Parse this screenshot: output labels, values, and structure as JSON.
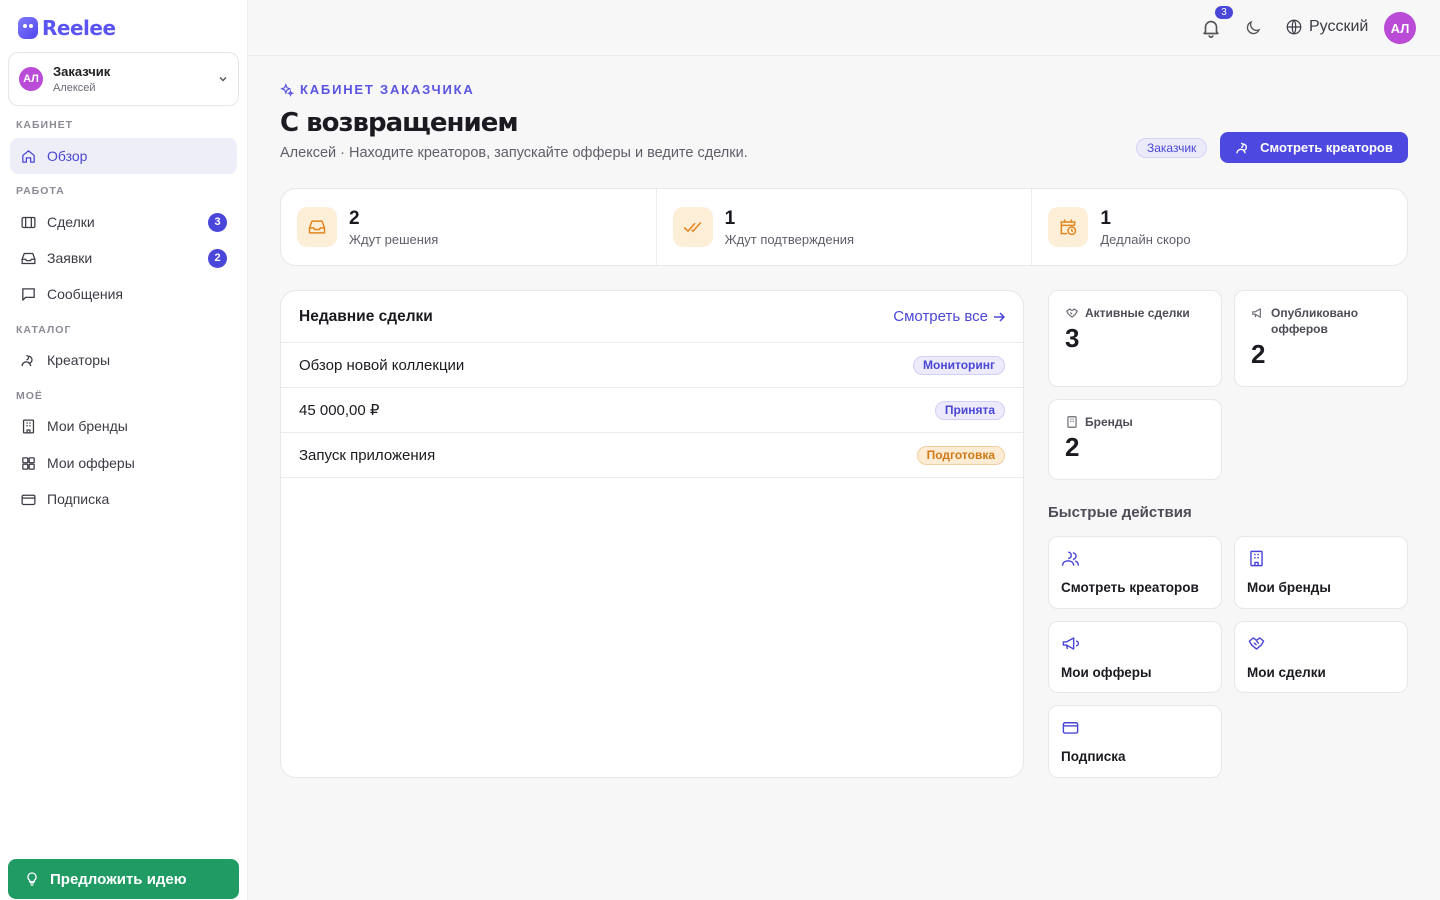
{
  "app": {
    "name": "Reelee"
  },
  "account": {
    "initials": "АЛ",
    "role": "Заказчик",
    "name": "Алексей"
  },
  "sidebar": {
    "sections": [
      "КАБИНЕТ",
      "РАБОТА",
      "КАТАЛОГ",
      "МОЁ"
    ],
    "items": [
      {
        "label": "Обзор",
        "icon": "home-icon",
        "active": true
      },
      {
        "label": "Сделки",
        "icon": "handshake-icon",
        "badge": "3"
      },
      {
        "label": "Заявки",
        "icon": "inbox-icon",
        "badge": "2"
      },
      {
        "label": "Сообщения",
        "icon": "message-icon"
      },
      {
        "label": "Креаторы",
        "icon": "users-icon"
      },
      {
        "label": "Мои бренды",
        "icon": "building-icon"
      },
      {
        "label": "Мои офферы",
        "icon": "grid-icon"
      },
      {
        "label": "Подписка",
        "icon": "credit-card-icon"
      }
    ],
    "idea_button": "Предложить идею"
  },
  "topbar": {
    "notifications_count": "3",
    "language": "Русский",
    "user_initials": "АЛ"
  },
  "header": {
    "eyebrow": "КАБИНЕТ ЗАКАЗЧИКА",
    "title": "С возвращением",
    "subtitle": "Алексей · Находите креаторов, запускайте офферы и ведите сделки.",
    "role_badge": "Заказчик",
    "primary_button": "Смотреть креаторов"
  },
  "stats": [
    {
      "value": "2",
      "label": "Ждут решения",
      "icon": "inbox-icon"
    },
    {
      "value": "1",
      "label": "Ждут подтверждения",
      "icon": "double-check-icon"
    },
    {
      "value": "1",
      "label": "Дедлайн скоро",
      "icon": "calendar-clock-icon"
    }
  ],
  "recent_deals": {
    "title": "Недавние сделки",
    "view_all": "Смотреть все",
    "rows": [
      {
        "name": "Обзор новой коллекции",
        "status": "Мониторинг",
        "status_color": "blue"
      },
      {
        "name": "45 000,00 ₽",
        "status": "Принята",
        "status_color": "blue"
      },
      {
        "name": "Запуск приложения",
        "status": "Подготовка",
        "status_color": "orange"
      }
    ]
  },
  "kpis": [
    {
      "label": "Активные сделки",
      "value": "3",
      "icon": "handshake-icon"
    },
    {
      "label": "Опубликовано офферов",
      "value": "2",
      "icon": "megaphone-icon"
    },
    {
      "label": "Бренды",
      "value": "2",
      "icon": "building-icon"
    }
  ],
  "quick_actions": {
    "title": "Быстрые действия",
    "items": [
      {
        "label": "Смотреть креаторов",
        "icon": "users-icon"
      },
      {
        "label": "Мои бренды",
        "icon": "building-icon"
      },
      {
        "label": "Мои офферы",
        "icon": "megaphone-icon"
      },
      {
        "label": "Мои сделки",
        "icon": "handshake-icon"
      },
      {
        "label": "Подписка",
        "icon": "credit-card-icon"
      }
    ]
  },
  "colors": {
    "accent": "#4d49e0",
    "success": "#1f9b63",
    "warning_bg": "#fdeed8",
    "avatar": "#b94bd6"
  }
}
